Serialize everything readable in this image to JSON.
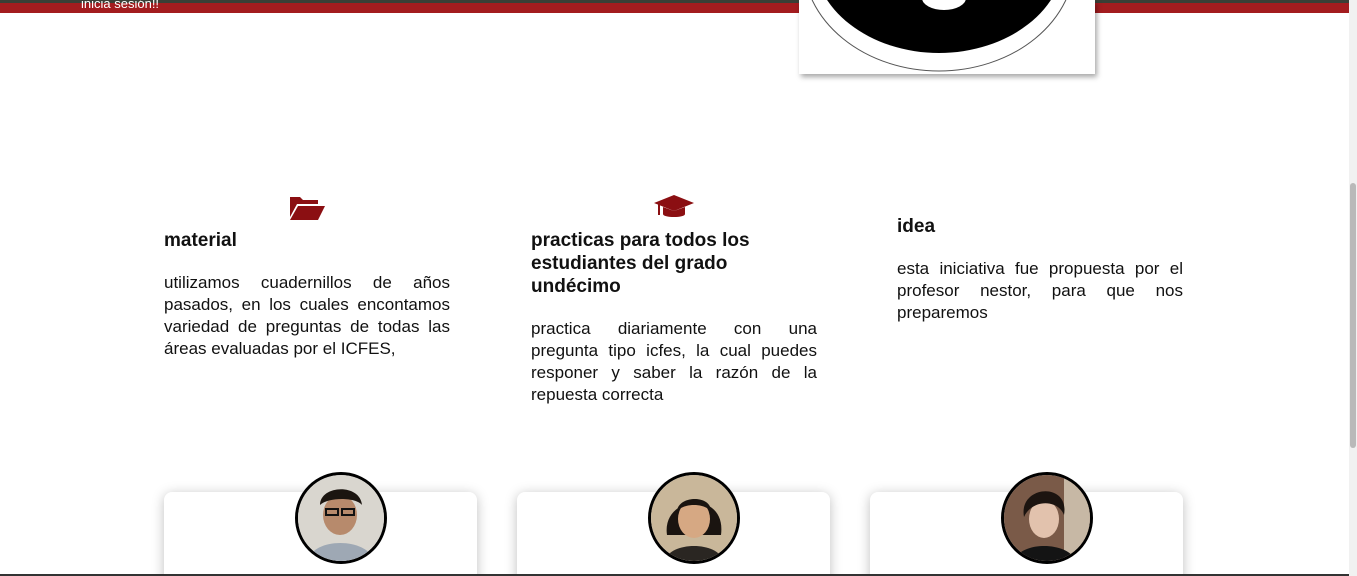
{
  "header": {
    "login_text": "inicia sesión!!"
  },
  "features": [
    {
      "icon": "open-folder-icon",
      "title": "material",
      "text": "utilizamos cuadernillos de años pasados, en los cuales encontamos variedad de preguntas de todas las áreas evaluadas por el ICFES,"
    },
    {
      "icon": "graduation-cap-icon",
      "title": "practicas para todos los estudiantes del grado undécimo",
      "text": "practica diariamente con una pregunta tipo icfes, la cual puedes responer y saber la razón de la repuesta correcta"
    },
    {
      "title": "idea",
      "text": "esta iniciativa fue propuesta por el profesor nestor, para que nos preparemos"
    }
  ],
  "colors": {
    "brand_red": "#a31c1f",
    "icon_red": "#8b0f12"
  }
}
